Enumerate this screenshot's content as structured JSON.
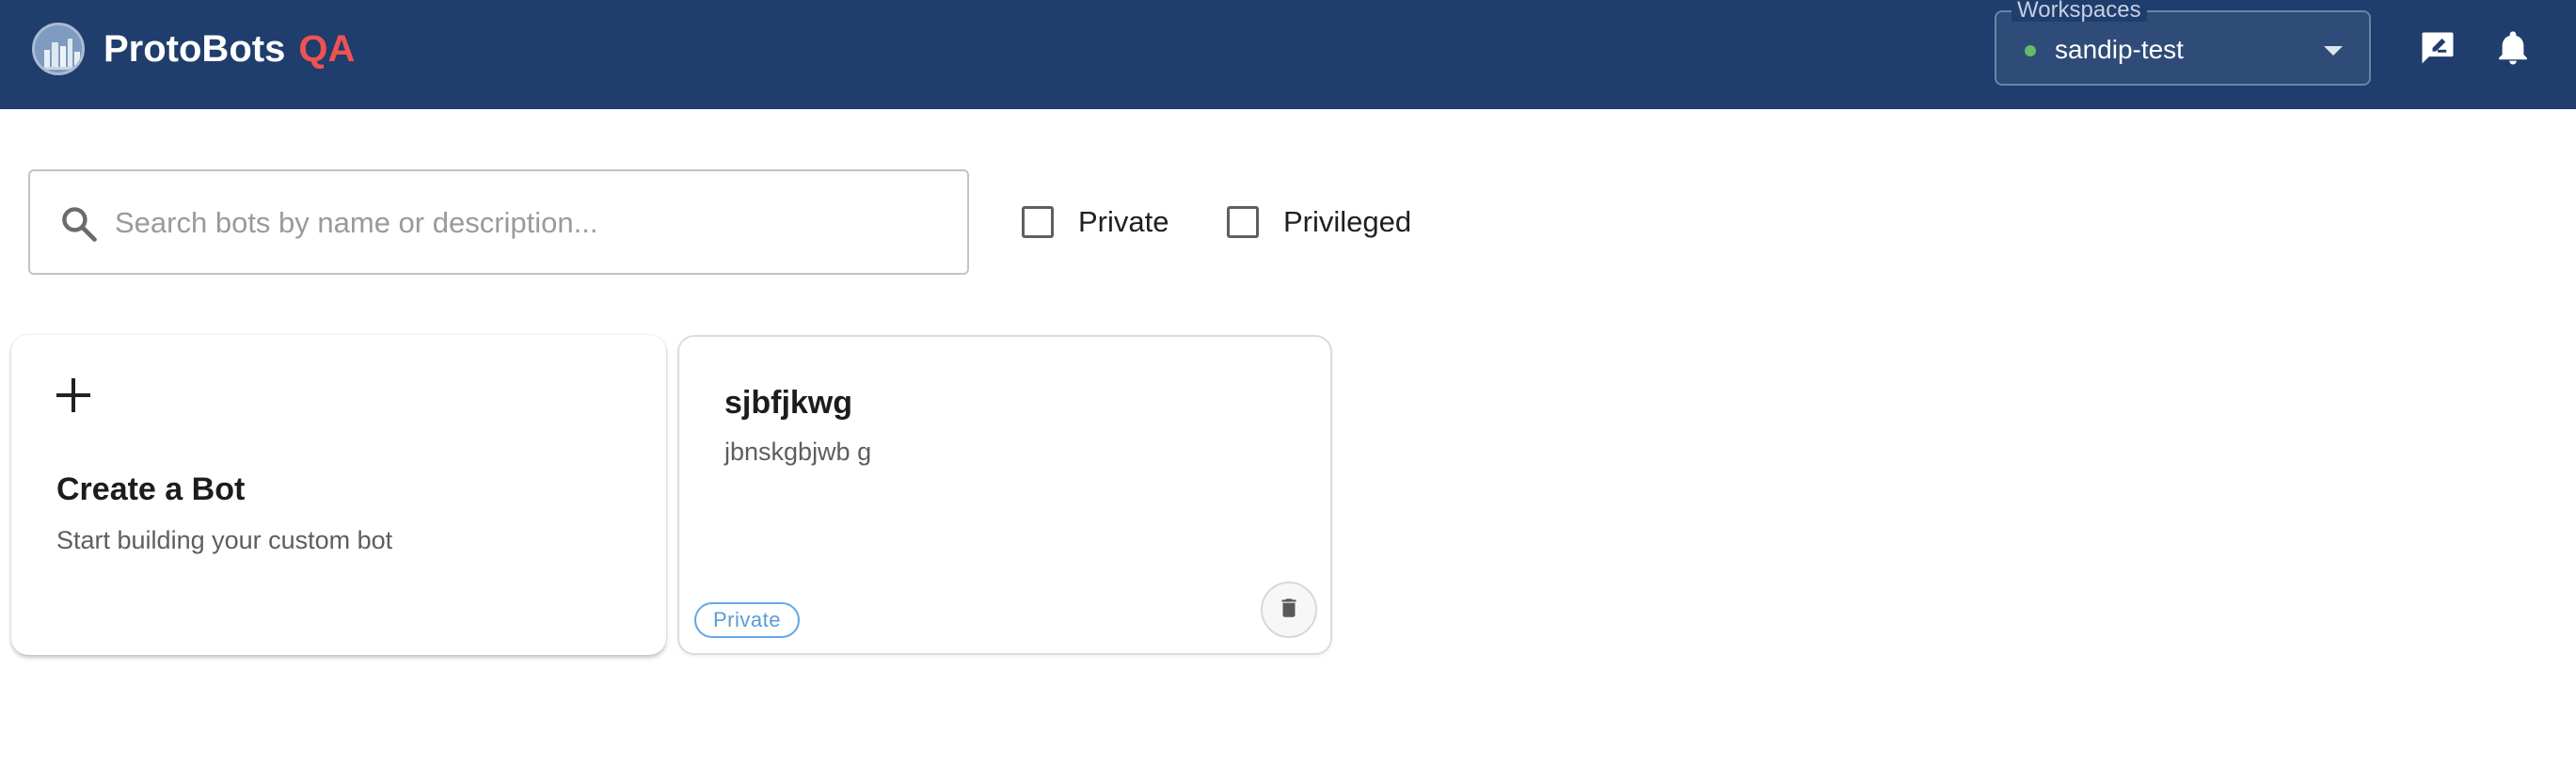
{
  "app": {
    "name": "ProtoBots",
    "env_badge": "QA",
    "logo_icon": "city-skyline-logo-icon"
  },
  "workspace": {
    "label": "Workspaces",
    "selected": "sandip-test",
    "status_color": "#66bb6a"
  },
  "header_icons": [
    "feedback-icon",
    "notifications-bell-icon"
  ],
  "search": {
    "placeholder": "Search bots by name or description...",
    "value": ""
  },
  "filters": [
    {
      "label": "Private",
      "checked": false
    },
    {
      "label": "Privileged",
      "checked": false
    }
  ],
  "create_card": {
    "title": "Create a Bot",
    "subtitle": "Start building your custom bot",
    "icon": "plus-icon"
  },
  "bots": [
    {
      "name": "sjbfjkwg",
      "description": "jbnskgbjwb g",
      "badge": "Private",
      "delete_icon": "trash-icon"
    }
  ],
  "colors": {
    "header_bg": "#1f3d6d",
    "env_badge": "#ef5350",
    "private_badge": "#5b9bd9"
  }
}
